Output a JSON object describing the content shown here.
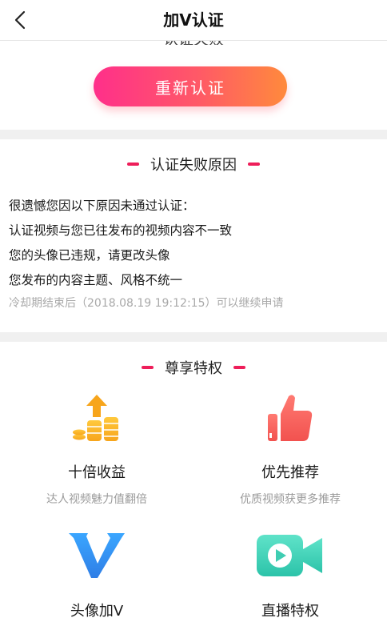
{
  "header": {
    "title": "加V认证"
  },
  "status": {
    "partial_text": "认证失败"
  },
  "reapply_button": {
    "label": "重新认证"
  },
  "reasons": {
    "title": "认证失败原因",
    "intro": "很遗憾您因以下原因未通过认证：",
    "items": [
      "认证视频与您已往发布的视频内容不一致",
      "您的头像已违规，请更改头像",
      "您发布的内容主题、风格不统一"
    ],
    "cooldown": "冷却期结束后（2018.08.19 19:12:15）可以继续申请"
  },
  "privileges": {
    "title": "尊享特权",
    "items": [
      {
        "name": "十倍收益",
        "desc": "达人视频魅力值翻倍",
        "icon": "coins-arrow-icon"
      },
      {
        "name": "优先推荐",
        "desc": "优质视频获更多推荐",
        "icon": "thumbs-up-icon"
      },
      {
        "name": "头像加V",
        "desc": "",
        "icon": "v-badge-icon"
      },
      {
        "name": "直播特权",
        "desc": "",
        "icon": "video-camera-icon"
      }
    ]
  },
  "colors": {
    "accent_pink": "#ee1e5a",
    "button_start": "#ff2f8a",
    "button_end": "#ff8a3c"
  }
}
